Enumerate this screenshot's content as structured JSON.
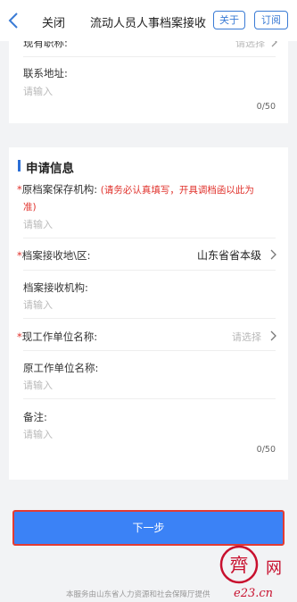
{
  "navbar": {
    "close_label": "关闭",
    "title": "流动人员人事档案接收",
    "about_label": "关于",
    "subscribe_label": "订阅"
  },
  "top_section": {
    "partial_label": "现有职称:",
    "partial_select_placeholder": "请选择",
    "address_label": "联系地址:",
    "address_placeholder": "请输入",
    "address_counter": "0/50"
  },
  "application": {
    "title": "申请信息",
    "original_org_label": "原档案保存机构:",
    "original_org_hint": "(请务必认真填写，开具调档函以此为",
    "original_org_hint_cont": "准)",
    "original_org_placeholder": "请输入",
    "receive_region_label": "档案接收地\\区:",
    "receive_region_value": "山东省省本级",
    "receive_org_label": "档案接收机构:",
    "receive_org_placeholder": "请输入",
    "current_employer_label": "现工作单位名称:",
    "current_employer_placeholder": "请选择",
    "former_employer_label": "原工作单位名称:",
    "former_employer_placeholder": "请输入",
    "remarks_label": "备注:",
    "remarks_placeholder": "请输入",
    "remarks_counter": "0/50",
    "required_mark": "*"
  },
  "actions": {
    "next_label": "下一步"
  },
  "footer": {
    "provider_text": "本服务由山东省人力资源和社会保障厅提供"
  },
  "watermark": {
    "logo_char": "齊",
    "side_text": "网",
    "site": "e23.cn"
  },
  "colors": {
    "accent": "#3b82f6",
    "required": "#e0312b",
    "highlight_border": "#e23b33",
    "watermark": "#c8102e"
  }
}
